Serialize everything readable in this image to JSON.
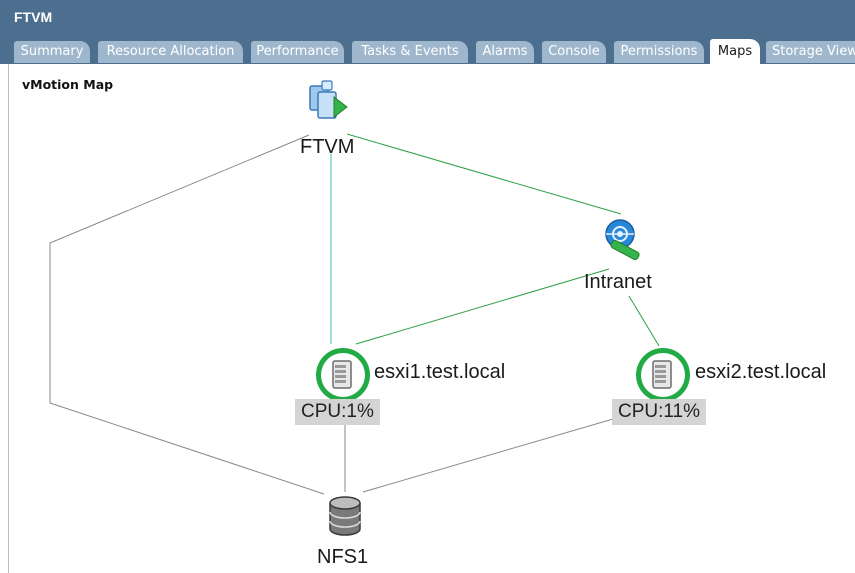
{
  "window": {
    "title": "FTVM"
  },
  "tabs": [
    {
      "label": "Summary"
    },
    {
      "label": "Resource Allocation"
    },
    {
      "label": "Performance"
    },
    {
      "label": "Tasks & Events"
    },
    {
      "label": "Alarms"
    },
    {
      "label": "Console"
    },
    {
      "label": "Permissions"
    },
    {
      "label": "Maps",
      "active": true
    },
    {
      "label": "Storage Views"
    }
  ],
  "map": {
    "title": "vMotion Map",
    "vm": {
      "name": "FTVM",
      "icon": "virtual-machine-icon"
    },
    "network": {
      "name": "Intranet",
      "icon": "network-icon"
    },
    "hosts": [
      {
        "name": "esxi1.test.local",
        "cpu": "CPU:1%",
        "icon": "host-server-icon",
        "status_color": "#22aa44"
      },
      {
        "name": "esxi2.test.local",
        "cpu": "CPU:11%",
        "icon": "host-server-icon",
        "status_color": "#22aa44"
      }
    ],
    "datastore": {
      "name": "NFS1",
      "icon": "datastore-icon"
    },
    "colors": {
      "network_line": "#2ea043",
      "host_line": "#5cc6c0",
      "storage_line": "#8a8a8a",
      "chrome": "#4d6f8f",
      "tab": "#9fb7cd"
    }
  }
}
